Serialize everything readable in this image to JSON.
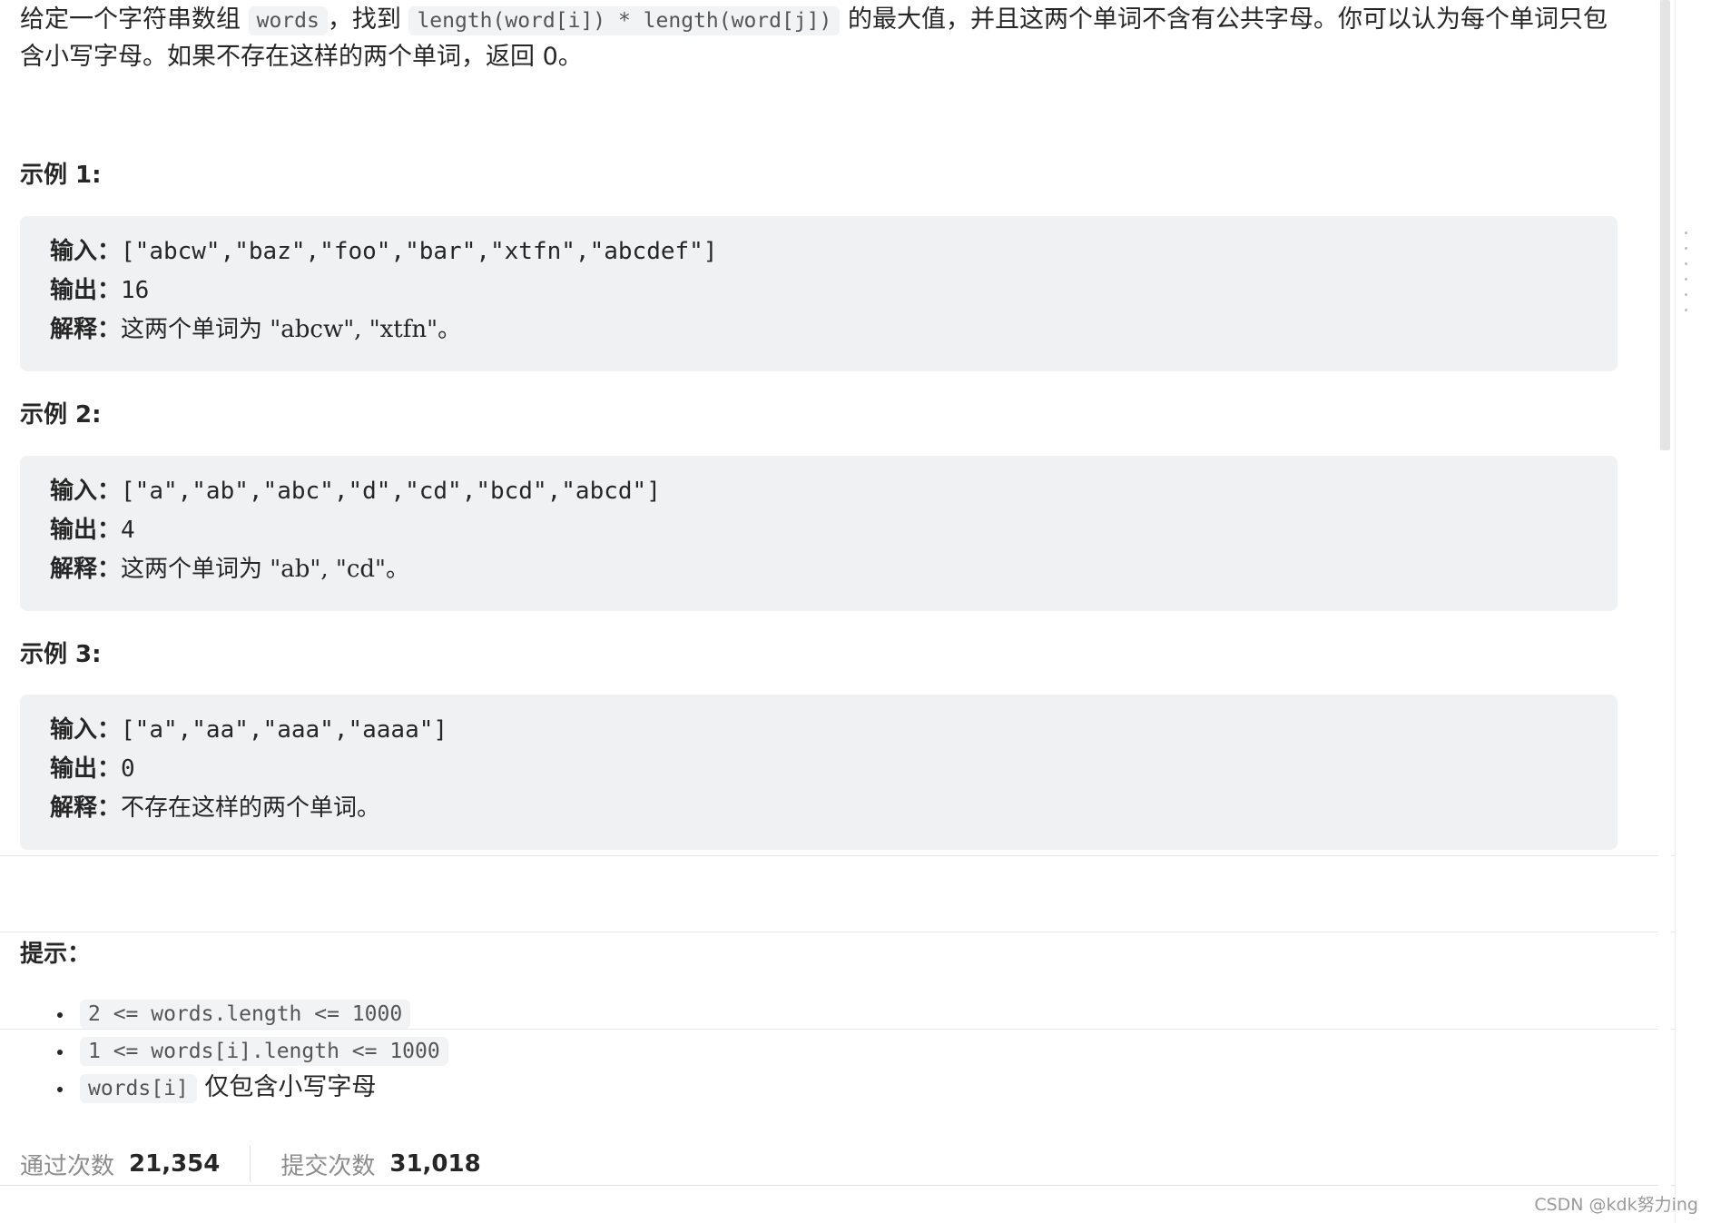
{
  "description": {
    "part1": "给定一个字符串数组 ",
    "code1": "words",
    "part2": "，找到 ",
    "code2": "length(word[i]) * length(word[j])",
    "part3": " 的最大值，并且这两个单词不含有公共字母。你可以认为每个单词只包含小写字母。如果不存在这样的两个单词，返回 0。"
  },
  "examples": [
    {
      "title": "示例 1:",
      "input_label": "输入：",
      "input": "[\"abcw\",\"baz\",\"foo\",\"bar\",\"xtfn\",\"abcdef\"]",
      "output_label": "输出：",
      "output": "16",
      "explain_label": "解释：",
      "explain": "这两个单词为 \"abcw\", \"xtfn\"。"
    },
    {
      "title": "示例 2:",
      "input_label": "输入：",
      "input": "[\"a\",\"ab\",\"abc\",\"d\",\"cd\",\"bcd\",\"abcd\"]",
      "output_label": "输出：",
      "output": "4",
      "explain_label": "解释：",
      "explain": "这两个单词为 \"ab\", \"cd\"。"
    },
    {
      "title": "示例 3:",
      "input_label": "输入：",
      "input": "[\"a\",\"aa\",\"aaa\",\"aaaa\"]",
      "output_label": "输出：",
      "output": "0",
      "explain_label": "解释：",
      "explain": "不存在这样的两个单词。"
    }
  ],
  "hints": {
    "title": "提示：",
    "items": [
      {
        "code": "2 <= words.length <= 1000",
        "text": ""
      },
      {
        "code": "1 <= words[i].length <= 1000",
        "text": ""
      },
      {
        "code": "words[i]",
        "text": "仅包含小写字母"
      }
    ]
  },
  "stats": {
    "accepted_label": "通过次数",
    "accepted_value": "21,354",
    "submitted_label": "提交次数",
    "submitted_value": "31,018"
  },
  "watermark": "CSDN @kdk努力ing"
}
